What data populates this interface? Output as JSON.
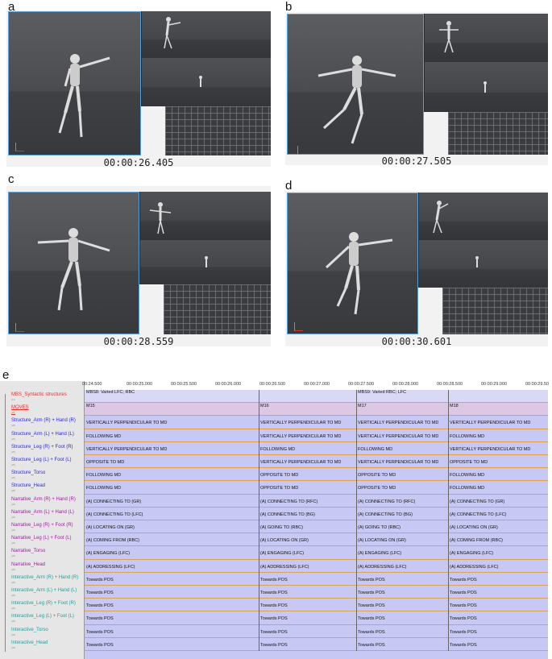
{
  "panels": [
    {
      "label": "a",
      "timecode": "00:00:26.405"
    },
    {
      "label": "b",
      "timecode": "00:00:27.505"
    },
    {
      "label": "c",
      "timecode": "00:00:28.559"
    },
    {
      "label": "d",
      "timecode": "00:00:30.601"
    }
  ],
  "timeline": {
    "label": "e",
    "ruler": [
      "00:24.500",
      "00:00:25.000",
      "00:00:25.500",
      "00:00:26.000",
      "00:00:26.500",
      "00:00:27.000",
      "00:00:27.500",
      "00:00:28.000",
      "00:00:28.500",
      "00:00:29.000",
      "00:00:29.50"
    ],
    "tiers": [
      {
        "name": "MBS_Syntactic structures",
        "sub": "[14]",
        "color": "#e03030"
      },
      {
        "name": "MOVES",
        "sub": "[28]",
        "color": "#e03030"
      },
      {
        "name": "Structure_Arm (R) + Hand (R)",
        "sub": "[28]",
        "color": "#2a2ae0"
      },
      {
        "name": "Structure_Arm (L) + Hand (L)",
        "sub": "[28]",
        "color": "#2a2ae0"
      },
      {
        "name": "Structure_Leg (R) + Foot (R)",
        "sub": "[28]",
        "color": "#2a2ae0"
      },
      {
        "name": "Structure_Leg (L) + Foot (L)",
        "sub": "[28]",
        "color": "#2a2ae0"
      },
      {
        "name": "Structure_Torso",
        "sub": "[28]",
        "color": "#2a2ae0"
      },
      {
        "name": "Structure_Head",
        "sub": "[28]",
        "color": "#2a2ae0"
      },
      {
        "name": "Narrative_Arm (R) + Hand (R)",
        "sub": "[28]",
        "color": "#a020a0"
      },
      {
        "name": "Narrative_Arm (L) + Hand (L)",
        "sub": "[28]",
        "color": "#a020a0"
      },
      {
        "name": "Narrative_Leg (R) + Foot (R)",
        "sub": "[28]",
        "color": "#a020a0"
      },
      {
        "name": "Narrative_Leg (L) + Foot (L)",
        "sub": "[28]",
        "color": "#a020a0"
      },
      {
        "name": "Narrative_Torso",
        "sub": "[28]",
        "color": "#a020a0"
      },
      {
        "name": "Narrative_Head",
        "sub": "[28]",
        "color": "#a020a0"
      },
      {
        "name": "Interactive_Arm (R) + Hand (R)",
        "sub": "[28]",
        "color": "#20a0a0"
      },
      {
        "name": "Interactive_Arm (L) + Hand (L)",
        "sub": "[28]",
        "color": "#20a0a0"
      },
      {
        "name": "Interactive_Leg (R) + Foot (R)",
        "sub": "[28]",
        "color": "#20a0a0"
      },
      {
        "name": "Interactive_Leg (L) + Foot (L)",
        "sub": "[28]",
        "color": "#20a0a0"
      },
      {
        "name": "Interactive_Torso",
        "sub": "[28]",
        "color": "#20a0a0"
      },
      {
        "name": "Interactive_Head",
        "sub": "[28]",
        "color": "#20a0a0"
      }
    ],
    "mbs_row": [
      "MBS8: Varied LFC; RBC",
      "MBS9: Varied RBC; LFC"
    ],
    "moves_row": [
      "M15",
      "M16",
      "M17",
      "M18"
    ],
    "rows": [
      [
        "VERTICALLY PERPENDICULAR TO MD",
        "VERTICALLY PERPENDICULAR TO MD",
        "VERTICALLY PERPENDICULAR TO MD",
        "VERTICALLY PERPENDICULAR TO MD"
      ],
      [
        "FOLLOWING MD",
        "VERTICALLY PERPENDICULAR TO MD",
        "VERTICALLY PERPENDICULAR TO MD",
        "FOLLOWING MD"
      ],
      [
        "VERTICALLY PERPENDICULAR TO MD",
        "FOLLOWING MD",
        "FOLLOWING MD",
        "VERTICALLY PERPENDICULAR TO MD"
      ],
      [
        "OPPOSITE TO MD",
        "VERTICALLY PERPENDICULAR TO MD",
        "VERTICALLY PERPENDICULAR TO MD",
        "OPPOSITE TO MD"
      ],
      [
        "FOLLOWING MD",
        "OPPOSITE TO MD",
        "OPPOSITE TO MD",
        "FOLLOWING MD"
      ],
      [
        "FOLLOWING MD",
        "OPPOSITE TO MD",
        "OPPOSITE TO MD",
        "FOLLOWING MD"
      ],
      [
        "(A) CONNECTING TO (GR)",
        "(A) CONNECTING TO (RFC)",
        "(A) CONNECTING TO (RFC)",
        "(A) CONNECTING TO (GR)"
      ],
      [
        "(A) CONNECTING TO (LFC)",
        "(A) CONNECTING TO (BG)",
        "(A) CONNECTING TO (BG)",
        "(A) CONNECTING TO (LFC)"
      ],
      [
        "(A) LOCATING ON (GR)",
        "(A) GOING TO (RBC)",
        "(A) GOING TO (RBC)",
        "(A) LOCATING ON (GR)"
      ],
      [
        "(A) COMING FROM (RBC)",
        "(A) LOCATING ON (GR)",
        "(A) LOCATING ON (GR)",
        "(A) COMING FROM (RBC)"
      ],
      [
        "(A) ENGAGING (LFC)",
        "(A) ENGAGING (LFC)",
        "(A) ENGAGING (LFC)",
        "(A) ENGAGING (LFC)"
      ],
      [
        "(A) ADDRESSING (LFC)",
        "(A) ADDRESSING (LFC)",
        "(A) ADDRESSING (LFC)",
        "(A) ADDRESSING (LFC)"
      ],
      [
        "Towards POS",
        "Towards POS",
        "Towards POS",
        "Towards POS"
      ],
      [
        "Towards POS",
        "Towards POS",
        "Towards POS",
        "Towards POS"
      ],
      [
        "Towards POS",
        "Towards POS",
        "Towards POS",
        "Towards POS"
      ],
      [
        "Towards POS",
        "Towards POS",
        "Towards POS",
        "Towards POS"
      ],
      [
        "Towards POS",
        "Towards POS",
        "Towards POS",
        "Towards POS"
      ],
      [
        "Towards POS",
        "Towards POS",
        "Towards POS",
        "Towards POS"
      ]
    ]
  }
}
